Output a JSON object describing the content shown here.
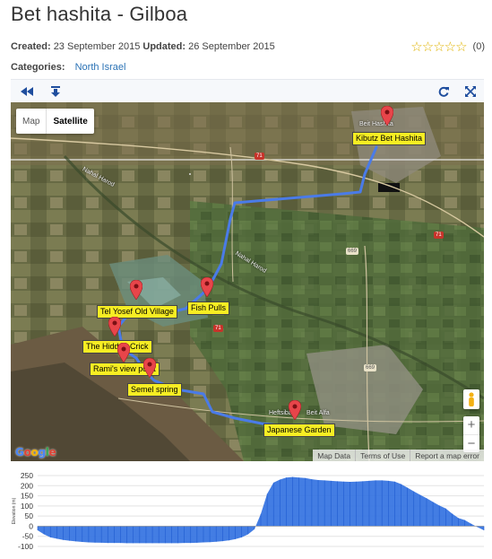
{
  "page": {
    "title": "Bet hashita - Gilboa",
    "created_label": "Created:",
    "created_value": "23 September 2015",
    "updated_label": "Updated:",
    "updated_value": "26 September 2015",
    "rating_stars": "☆☆☆☆☆",
    "rating_count": "(0)",
    "categories_label": "Categories:",
    "category_link": "North Israel"
  },
  "map": {
    "type_map": "Map",
    "type_satellite": "Satellite",
    "markers": [
      {
        "label": "Kibutz Bet Hashita"
      },
      {
        "label": "Tel Yosef Old Village"
      },
      {
        "label": "Fish Pulls"
      },
      {
        "label": "The Hidden Crick"
      },
      {
        "label": "Rami's view point"
      },
      {
        "label": "Semel spring"
      },
      {
        "label": "Japanese Garden"
      }
    ],
    "place_names": [
      "Beit Hashita",
      "Heftsiba",
      "Beit Alfa",
      "Nahal Harod",
      "Nahal Harod"
    ],
    "road_numbers": [
      "71",
      "71",
      "669",
      "669",
      "71"
    ],
    "zoom_in": "+",
    "zoom_out": "−",
    "google_logo": "Google",
    "footer": {
      "map_data": "Map Data",
      "terms": "Terms of Use",
      "report": "Report a map error"
    }
  },
  "colors": {
    "route": "#4a7be8",
    "label_bg": "#f7ed23",
    "marker": "#e8454a",
    "elevation_fill": "#2f6fe0",
    "link": "#2a72b5",
    "stars": "#e0b400"
  },
  "icons": [
    "rewind-icon",
    "download-icon",
    "refresh-icon",
    "fullscreen-icon",
    "pegman-icon",
    "map-marker-icon"
  ],
  "chart_data": {
    "type": "area",
    "ylabel": "Elevation (m)",
    "ylim": [
      -100,
      250
    ],
    "yticks": [
      250,
      200,
      150,
      100,
      50,
      0,
      -50,
      -100
    ],
    "grid": true,
    "x": [
      0,
      1,
      2,
      3,
      4,
      5,
      6,
      7,
      8,
      9,
      10,
      11,
      12,
      13,
      14,
      15,
      16,
      17,
      18,
      19,
      20,
      21,
      22,
      23,
      24,
      25,
      26,
      27,
      28,
      29,
      30,
      31,
      32,
      33,
      34,
      35,
      36,
      37,
      38,
      39,
      40,
      41,
      42,
      43,
      44,
      45,
      46,
      47,
      48,
      49,
      50,
      51,
      52,
      53,
      54,
      55,
      56,
      57,
      58,
      59,
      60,
      61,
      62,
      63,
      64,
      65,
      66,
      67,
      68,
      69,
      70
    ],
    "values": [
      -20,
      -40,
      -55,
      -62,
      -68,
      -72,
      -75,
      -78,
      -80,
      -81,
      -82,
      -83,
      -83,
      -83,
      -84,
      -84,
      -84,
      -84,
      -84,
      -84,
      -84,
      -84,
      -84,
      -83,
      -83,
      -82,
      -80,
      -79,
      -77,
      -74,
      -70,
      -64,
      -55,
      -40,
      -15,
      60,
      160,
      215,
      230,
      240,
      243,
      240,
      238,
      232,
      228,
      226,
      224,
      222,
      220,
      219,
      220,
      222,
      224,
      226,
      226,
      224,
      220,
      208,
      190,
      172,
      155,
      138,
      120,
      102,
      88,
      62,
      40,
      30,
      12,
      -5,
      -20
    ]
  }
}
